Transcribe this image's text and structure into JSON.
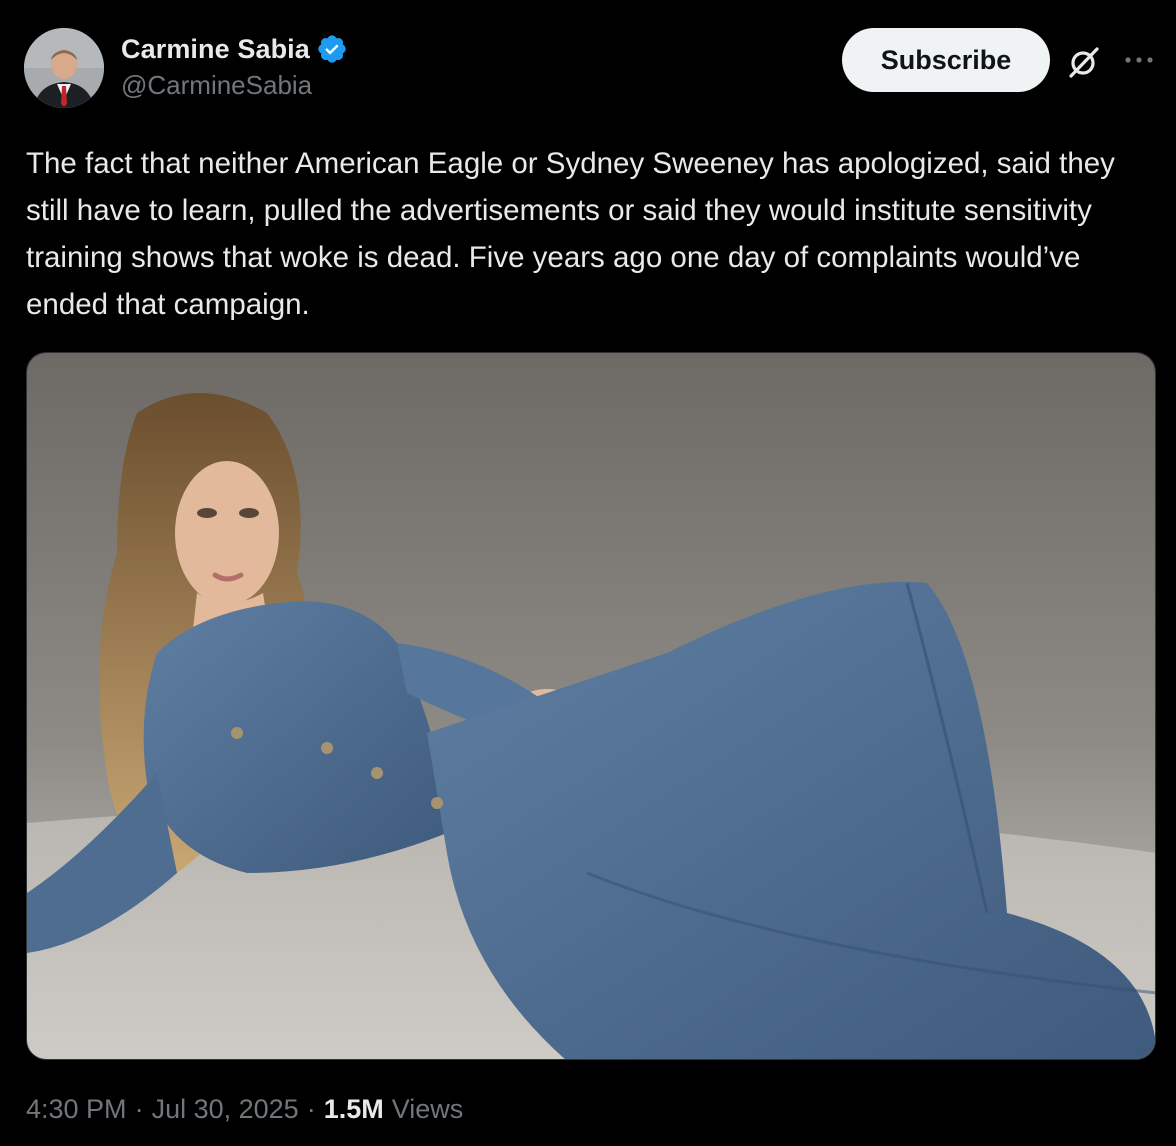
{
  "author": {
    "display_name": "Carmine Sabia",
    "handle": "@CarmineSabia",
    "verified": true,
    "verified_color": "#1d9bf0"
  },
  "actions": {
    "subscribe_label": "Subscribe",
    "grok_icon": "grok-icon",
    "more_icon": "more-horizontal-icon"
  },
  "post": {
    "text": "The fact that neither American Eagle or Sydney Sweeney has apologized, said they still have to learn, pulled the advertisements or said they would institute sensitivity training shows that woke is dead. Five years ago one day of complaints would’ve ended that campaign.",
    "media_description": "photo"
  },
  "meta": {
    "time": "4:30 PM",
    "separator": "·",
    "date": "Jul 30, 2025",
    "views_count": "1.5M",
    "views_label": "Views"
  },
  "colors": {
    "background": "#000000",
    "text_primary": "#e7e9ea",
    "text_secondary": "#71767b",
    "button_bg": "#eff3f4"
  }
}
